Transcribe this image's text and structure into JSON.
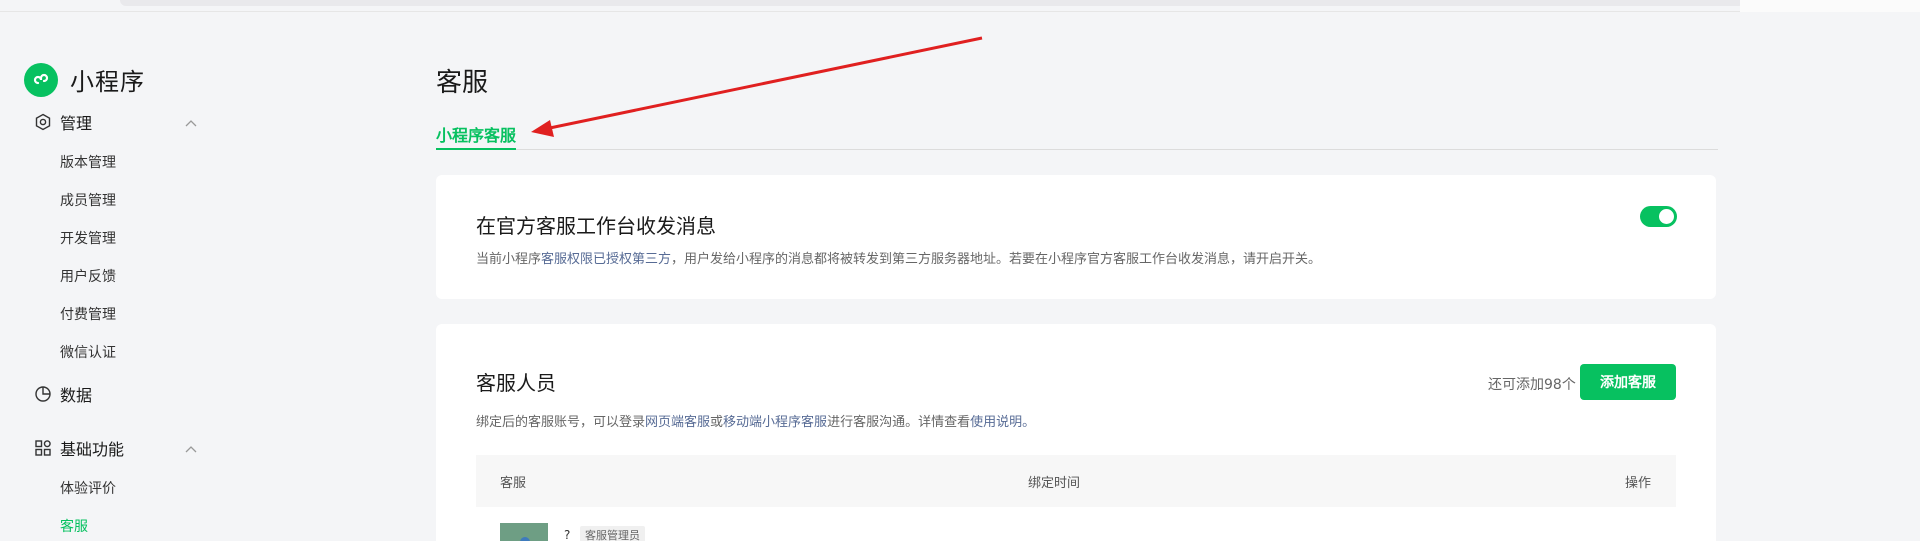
{
  "sidebar": {
    "app_name": "小程序",
    "groups": [
      {
        "label": "管理",
        "items": [
          "版本管理",
          "成员管理",
          "开发管理",
          "用户反馈",
          "付费管理",
          "微信认证"
        ]
      },
      {
        "label": "数据",
        "items": []
      },
      {
        "label": "基础功能",
        "items": [
          "体验评价",
          "客服"
        ]
      }
    ],
    "active_item": "客服"
  },
  "main": {
    "title": "客服",
    "tab": "小程序客服",
    "card1": {
      "title": "在官方客服工作台收发消息",
      "desc_prefix": "当前小程序",
      "desc_link": "客服权限已授权第三方",
      "desc_suffix": "，用户发给小程序的消息都将被转发到第三方服务器地址。若要在小程序官方客服工作台收发消息，请开启开关。",
      "toggle_on": true
    },
    "card2": {
      "title": "客服人员",
      "desc_prefix": "绑定后的客服账号，可以登录",
      "desc_link1": "网页端客服",
      "desc_mid1": "或",
      "desc_link2": "移动端小程序客服",
      "desc_mid2": "进行客服沟通。详情查看",
      "desc_link3": "使用说明",
      "desc_end": "。",
      "remain": "还可添加98个",
      "add_button": "添加客服",
      "columns": [
        "客服",
        "绑定时间",
        "操作"
      ],
      "rows": [
        {
          "name": "?",
          "badge": "客服管理员"
        }
      ]
    }
  },
  "colors": {
    "accent": "#07c160",
    "link": "#576b95",
    "arrow": "#e02020"
  }
}
